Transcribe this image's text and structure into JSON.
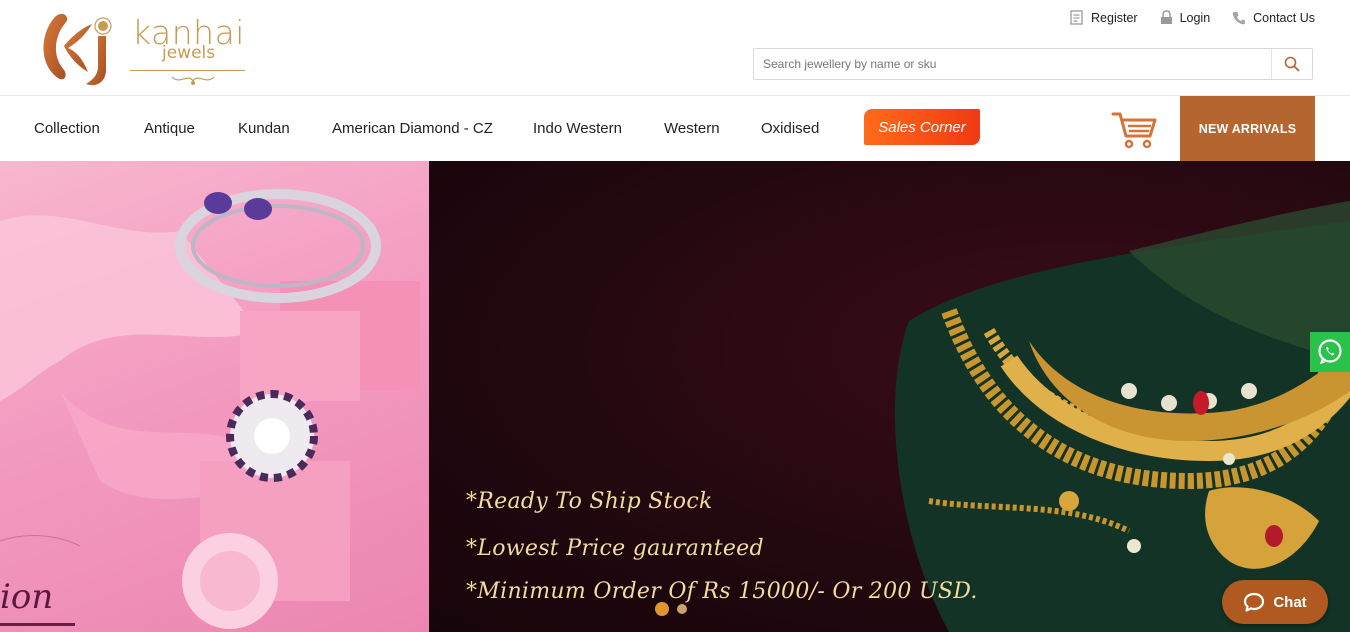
{
  "brand": {
    "name": "kanhai",
    "tagline": "jewels",
    "accent": "#c79b4f",
    "logo_color": "#c0672f"
  },
  "top_links": [
    {
      "label": "Register",
      "icon": "register-icon"
    },
    {
      "label": "Login",
      "icon": "lock-icon"
    },
    {
      "label": "Contact Us",
      "icon": "phone-icon"
    }
  ],
  "search": {
    "placeholder": "Search jewellery by name or sku",
    "value": ""
  },
  "nav": {
    "items": [
      "Collection",
      "Antique",
      "Kundan",
      "American Diamond - CZ",
      "Indo Western",
      "Western",
      "Oxidised"
    ],
    "sales_label": "Sales Corner",
    "new_arrivals_label": "NEW ARRIVALS",
    "new_arrivals_color": "#b46530",
    "sales_color": "#f04e18"
  },
  "hero": {
    "lines": [
      "*Ready To Ship Stock",
      "*Lowest Price gauranteed",
      "*Minimum Order Of Rs 15000/- Or 200 USD."
    ],
    "left_caption": "ion",
    "slides": 2,
    "active_slide": 1
  },
  "widgets": {
    "chat_label": "Chat",
    "whatsapp_color": "#29c24a",
    "chat_color": "#b05a22"
  }
}
